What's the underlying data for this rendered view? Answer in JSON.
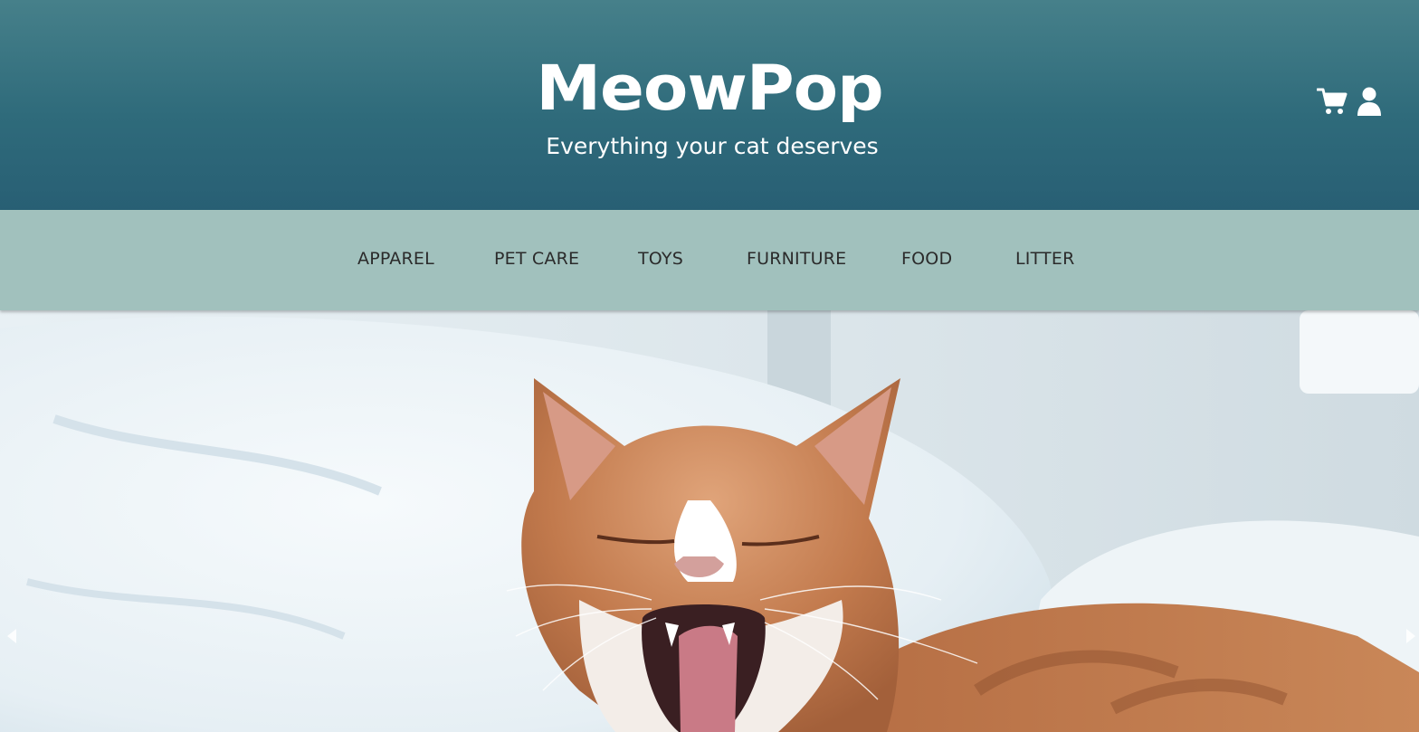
{
  "header": {
    "brand": "MeowPop",
    "tagline": "Everything your cat deserves",
    "icons": [
      "cart-icon",
      "user-icon"
    ]
  },
  "nav": {
    "items": [
      {
        "label": "APPAREL"
      },
      {
        "label": "PET CARE"
      },
      {
        "label": "TOYS"
      },
      {
        "label": "FURNITURE"
      },
      {
        "label": "FOOD"
      },
      {
        "label": "LITTER"
      }
    ]
  },
  "hero": {
    "carousel_controls": [
      "chevron-left-icon",
      "chevron-right-icon"
    ]
  },
  "colors": {
    "header_top": "#46808a",
    "header_bottom": "#285f74",
    "nav_bg": "#a1c1bd",
    "nav_text": "#2b2b2b"
  }
}
